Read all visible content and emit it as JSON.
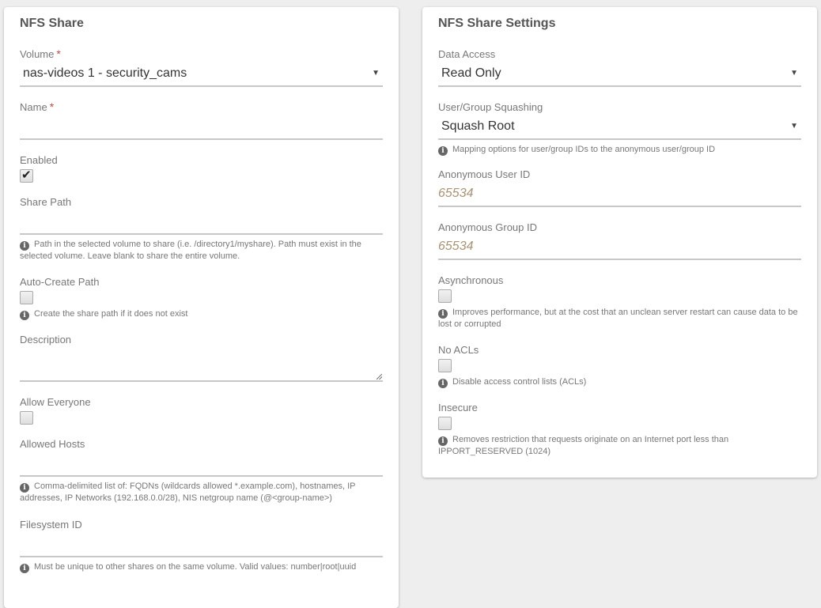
{
  "left": {
    "title": "NFS Share",
    "volume": {
      "label": "Volume",
      "required": "*",
      "value": "nas-videos 1 - security_cams"
    },
    "name": {
      "label": "Name",
      "required": "*",
      "value": ""
    },
    "enabled": {
      "label": "Enabled",
      "checked": true
    },
    "share_path": {
      "label": "Share Path",
      "value": "",
      "help": "Path in the selected volume to share (i.e. /directory1/myshare). Path must exist in the selected volume. Leave blank to share the entire volume."
    },
    "auto_create": {
      "label": "Auto-Create Path",
      "checked": false,
      "help": "Create the share path if it does not exist"
    },
    "description": {
      "label": "Description",
      "value": ""
    },
    "allow_everyone": {
      "label": "Allow Everyone",
      "checked": false
    },
    "allowed_hosts": {
      "label": "Allowed Hosts",
      "value": "",
      "help": "Comma-delimited list of: FQDNs (wildcards allowed *.example.com), hostnames, IP addresses, IP Networks (192.168.0.0/28), NIS netgroup name (@<group-name>)"
    },
    "filesystem_id": {
      "label": "Filesystem ID",
      "value": "",
      "help": "Must be unique to other shares on the same volume. Valid values: number|root|uuid"
    }
  },
  "right": {
    "title": "NFS Share Settings",
    "data_access": {
      "label": "Data Access",
      "value": "Read Only"
    },
    "squashing": {
      "label": "User/Group Squashing",
      "value": "Squash Root",
      "help": "Mapping options for user/group IDs to the anonymous user/group ID"
    },
    "anon_uid": {
      "label": "Anonymous User ID",
      "placeholder": "65534"
    },
    "anon_gid": {
      "label": "Anonymous Group ID",
      "placeholder": "65534"
    },
    "async": {
      "label": "Asynchronous",
      "checked": false,
      "help": "Improves performance, but at the cost that an unclean server restart can cause data to be lost or corrupted"
    },
    "no_acls": {
      "label": "No ACLs",
      "checked": false,
      "help": "Disable access control lists (ACLs)"
    },
    "insecure": {
      "label": "Insecure",
      "checked": false,
      "help": "Removes restriction that requests originate on an Internet port less than IPPORT_RESERVED (1024)"
    }
  },
  "icons": {
    "info": "i",
    "dropdown": "▼",
    "check": "✔"
  }
}
